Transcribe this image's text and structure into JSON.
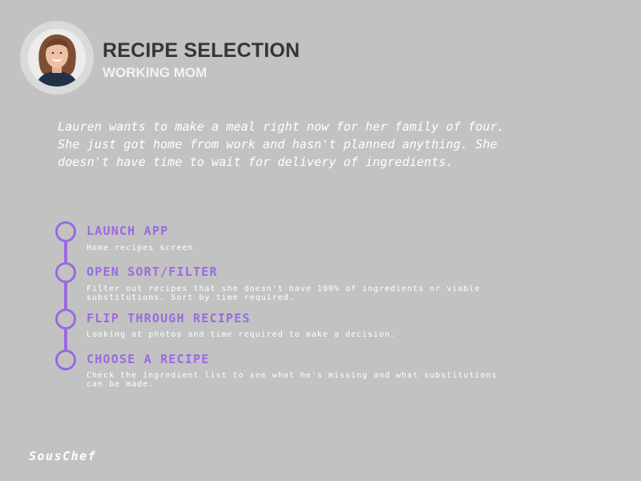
{
  "header": {
    "title": "RECIPE SELECTION",
    "subtitle": "WORKING MOM"
  },
  "scenario": "Lauren wants to make a meal right now for her family of four. She just got home from work and hasn't planned anything. She doesn't have time to wait for delivery of ingredients.",
  "steps": [
    {
      "title": "LAUNCH APP",
      "description": "Home recipes screen"
    },
    {
      "title": "OPEN SORT/FILTER",
      "description": "Filter out recipes that she doesn't have 100% of ingredients or viable substitutions. Sort by time required."
    },
    {
      "title": "FLIP THROUGH RECIPES",
      "description": "Looking at photos and time required to make a decision."
    },
    {
      "title": "CHOOSE A RECIPE",
      "description": "Check the ingredient list to see what he's missing and what substitutions can be made."
    }
  ],
  "footer": {
    "brand": "SousChef"
  },
  "colors": {
    "background": "#c2c2c2",
    "accent": "#9a6ae0",
    "title": "#363636",
    "text": "#ffffff"
  },
  "icons": {
    "avatar": "persona-photo",
    "step_marker": "timeline-circle-icon"
  }
}
